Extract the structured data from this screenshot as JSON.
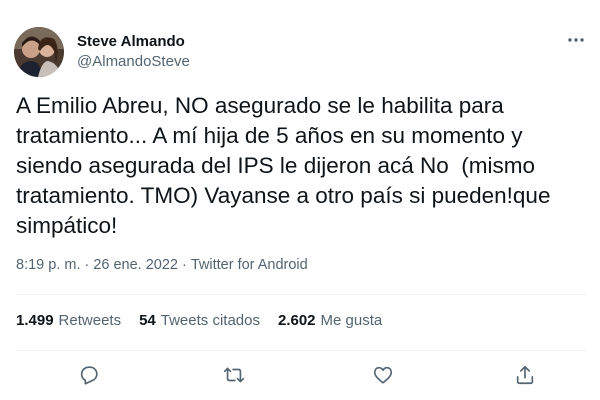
{
  "author": {
    "display_name": "Steve Almando",
    "handle": "@AlmandoSteve"
  },
  "tweet": {
    "text": "A Emilio Abreu, NO asegurado se le habilita para tratamiento... A mí hija de 5 años en su momento y siendo asegurada del IPS le dijeron acá No  (mismo tratamiento. TMO) Vayanse a otro país si pueden!que simpático!",
    "time": "8:19 p. m.",
    "separator": "·",
    "date": "26 ene. 2022",
    "source": "Twitter for Android"
  },
  "stats": [
    {
      "count": "1.499",
      "label": "Retweets"
    },
    {
      "count": "54",
      "label": "Tweets citados"
    },
    {
      "count": "2.602",
      "label": "Me gusta"
    }
  ],
  "icons": {
    "more": "more-horizontal-icon",
    "reply": "reply-icon",
    "retweet": "retweet-icon",
    "like": "heart-icon",
    "share": "share-icon"
  },
  "colors": {
    "text_primary": "#0f1419",
    "text_secondary": "#536471",
    "divider": "#eff3f4"
  }
}
